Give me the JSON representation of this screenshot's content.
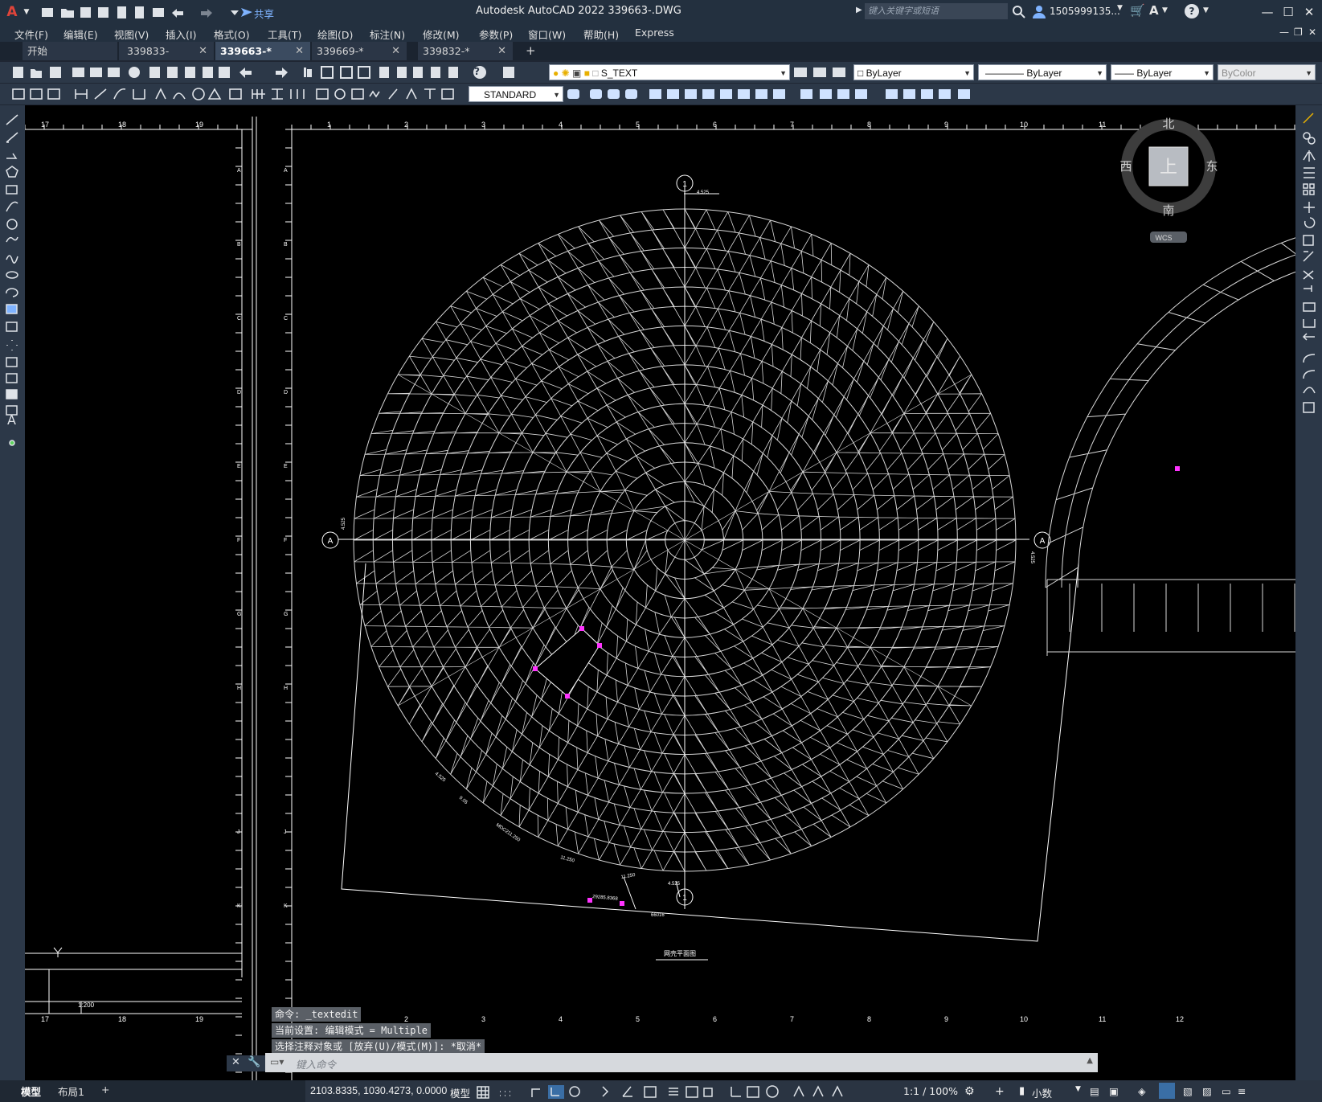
{
  "titlebar": {
    "app_title": "Autodesk AutoCAD 2022    339663-.DWG",
    "share_label": "共享",
    "search_placeholder": "键入关键字或短语",
    "user": "1505999135...",
    "logo": "A"
  },
  "menu": [
    "文件(F)",
    "编辑(E)",
    "视图(V)",
    "插入(I)",
    "格式(O)",
    "工具(T)",
    "绘图(D)",
    "标注(N)",
    "修改(M)",
    "参数(P)",
    "窗口(W)",
    "帮助(H)",
    "Express"
  ],
  "tabs": [
    {
      "label": "开始",
      "close": ""
    },
    {
      "label": "339833-",
      "close": "✕"
    },
    {
      "label": "339663-*",
      "close": "✕"
    },
    {
      "label": "339669-*",
      "close": "✕"
    },
    {
      "label": "339832-*",
      "close": "✕"
    }
  ],
  "tab_add": "+",
  "toolbar": {
    "layer_name": "S_TEXT",
    "color": "ByLayer",
    "linetype": "ByLayer",
    "lineweight": "ByLayer",
    "plotstyle": "ByColor",
    "textstyle": "STANDARD"
  },
  "viewcube": {
    "north": "北",
    "south": "南",
    "east": "东",
    "west": "西",
    "top": "上",
    "wcs": "WCS"
  },
  "ruler_left": {
    "top": [
      "17",
      "18",
      "19"
    ],
    "rows": [
      "A",
      "B",
      "C",
      "D",
      "E",
      "F",
      "G",
      "H",
      "J",
      "K"
    ]
  },
  "ruler_main": {
    "top": [
      "1",
      "2",
      "3",
      "4",
      "5",
      "6",
      "7",
      "8",
      "9",
      "10",
      "11",
      "12"
    ],
    "rows": [
      "A",
      "B",
      "C",
      "D",
      "E",
      "F",
      "G",
      "H",
      "J",
      "K"
    ]
  },
  "axis_bubbles": {
    "top": "1",
    "bottom": "1",
    "left": "A",
    "right": "A"
  },
  "dimensions": {
    "top": "4.525",
    "left": "4.525",
    "right": "4.525",
    "bottom_a": "4.525",
    "bottom_b": "11.250",
    "base": "66016",
    "arc1": "4.525",
    "arc2": "9.05",
    "arc3": "MDC211.250",
    "arc4": "11.250",
    "chord": "29285.8368"
  },
  "drawing_title": "网壳平面图",
  "commands": [
    "命令: _textedit",
    "当前设置: 编辑模式 = Multiple",
    "选择注释对象或 [放弃(U)/模式(M)]: *取消*"
  ],
  "command_placeholder": "键入命令",
  "left_panel": {
    "scale": "1:200"
  },
  "layout_tabs": [
    "模型",
    "布局1",
    "+"
  ],
  "status": {
    "coords": "2103.8335, 1030.4273, 0.0000",
    "model": "模型",
    "annot_scale": "1:1 / 100%",
    "units": "小数"
  }
}
